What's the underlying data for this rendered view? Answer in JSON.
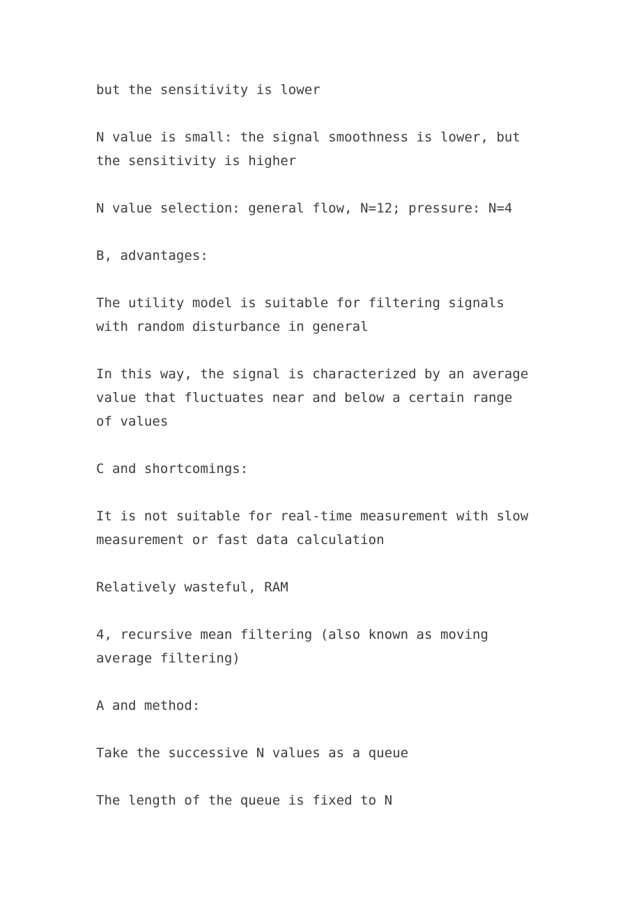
{
  "document": {
    "page_background": "#ffffff",
    "text_color": "#3c3c3c",
    "paragraphs": [
      {
        "text": "but the sensitivity is lower"
      },
      {
        "text": "N value is small: the signal smoothness is lower, but the sensitivity is higher"
      },
      {
        "text": "N value selection: general flow, N=12; pressure: N=4"
      },
      {
        "text": "B, advantages:"
      },
      {
        "text": "The utility model is suitable for filtering signals with random disturbance in general"
      },
      {
        "text": "In this way, the signal is characterized by an average value that fluctuates near and below a certain range of values"
      },
      {
        "text": "C and shortcomings:"
      },
      {
        "text": "It is not suitable for real-time measurement with slow measurement or fast data calculation"
      },
      {
        "text": "Relatively wasteful, RAM"
      },
      {
        "text": "4, recursive mean filtering (also known as moving average filtering)"
      },
      {
        "text": "A and method:"
      },
      {
        "text": "Take the successive N values as a queue"
      },
      {
        "text": "The length of the queue is fixed to N"
      }
    ]
  }
}
